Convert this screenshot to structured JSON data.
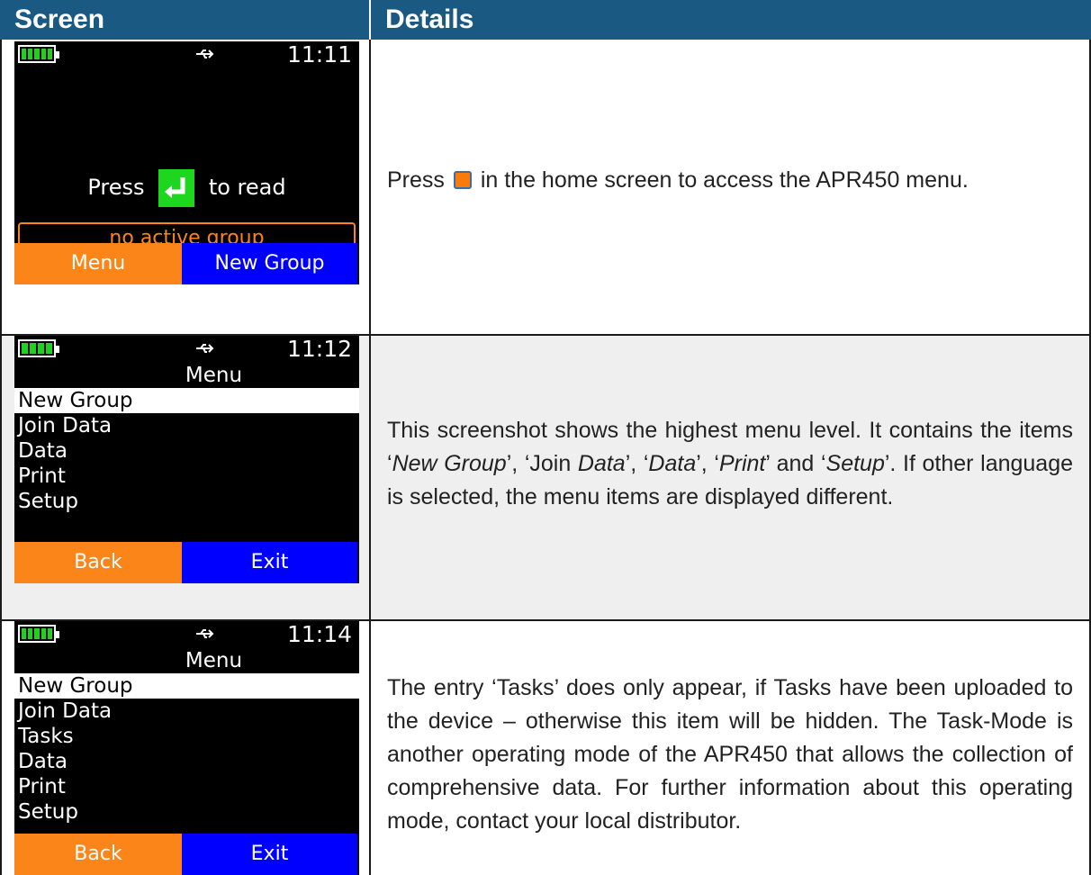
{
  "header": {
    "col_screen": "Screen",
    "col_details": "Details"
  },
  "colors": {
    "header_bg": "#1a5a82",
    "softkey_orange": "#fb8519",
    "softkey_blue": "#0000ff",
    "battery_green": "#22d022",
    "enter_green": "#1ed61e"
  },
  "rows": [
    {
      "device": {
        "time": "11:11",
        "press_before": "Press",
        "press_after": "to read",
        "group_status": "no active group",
        "softkey_left": "Menu",
        "softkey_right": "New Group"
      },
      "details": {
        "before_icon": "Press",
        "after_icon": "in the home screen to access the APR450 menu.",
        "icon": "orange-button-icon"
      }
    },
    {
      "device": {
        "time": "11:12",
        "title": "Menu",
        "items": [
          "New Group",
          "Join Data",
          "Data",
          "Print",
          "Setup"
        ],
        "softkey_left": "Back",
        "softkey_right": "Exit"
      },
      "details": {
        "t1": "This screenshot shows the highest menu level. It contains the items ‘",
        "i1": "New Group",
        "t2": "’, ‘Join ",
        "i2": "Data",
        "t3": "’, ‘",
        "i3": "Data",
        "t4": "’, ‘",
        "i4": "Print",
        "t5": "’ and ‘",
        "i5": "Setup",
        "t6": "’. If other language is selected, the menu items are displayed different."
      }
    },
    {
      "device": {
        "time": "11:14",
        "title": "Menu",
        "items": [
          "New Group",
          "Join Data",
          "Tasks",
          "Data",
          "Print",
          "Setup"
        ],
        "softkey_left": "Back",
        "softkey_right": "Exit"
      },
      "details": {
        "text": "The entry ‘Tasks’ does only appear, if Tasks have been uploaded to the device – otherwise this item will be hidden. The Task-Mode is another operating mode of the APR450 that allows the collection of comprehensive data. For further information about this operating mode, contact your local distributor."
      }
    }
  ]
}
